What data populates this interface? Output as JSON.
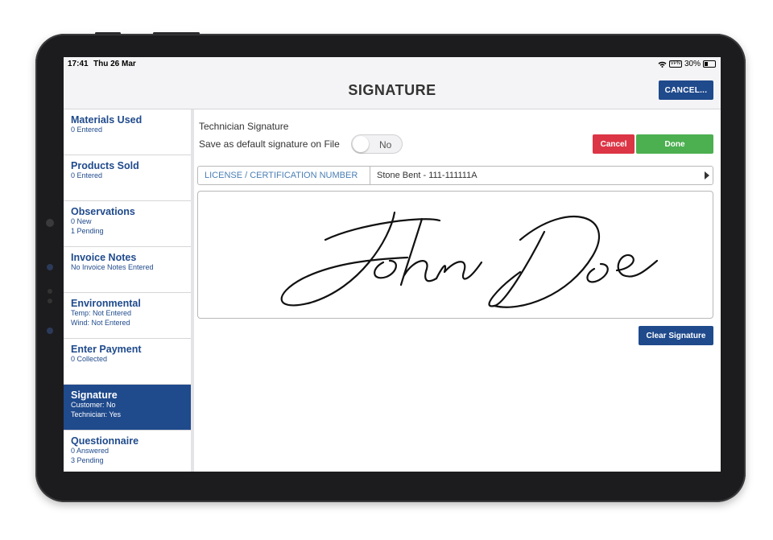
{
  "status_bar": {
    "time": "17:41",
    "date": "Thu 26 Mar",
    "vpn": "VPN",
    "battery": "30%",
    "icons": [
      "wifi-icon",
      "vpn-icon",
      "battery-icon"
    ]
  },
  "header": {
    "title": "SIGNATURE",
    "cancel_label": "CANCEL..."
  },
  "sidebar": {
    "items": [
      {
        "label": "Materials Used",
        "lines": [
          "0 Entered"
        ]
      },
      {
        "label": "Products Sold",
        "lines": [
          "0 Entered"
        ]
      },
      {
        "label": "Observations",
        "lines": [
          "0 New",
          "1 Pending"
        ]
      },
      {
        "label": "Invoice Notes",
        "lines": [
          "No Invoice Notes Entered"
        ]
      },
      {
        "label": "Environmental",
        "lines": [
          "Temp: Not Entered",
          "Wind: Not Entered"
        ]
      },
      {
        "label": "Enter Payment",
        "lines": [
          "0 Collected"
        ]
      },
      {
        "label": "Signature",
        "lines": [
          "Customer: No",
          "Technician: Yes"
        ],
        "active": true
      },
      {
        "label": "Questionnaire",
        "lines": [
          "0 Answered",
          "3 Pending"
        ]
      }
    ]
  },
  "main": {
    "section_title": "Technician Signature",
    "default_label": "Save as default signature on File",
    "toggle_value": "No",
    "cancel_label": "Cancel",
    "done_label": "Done",
    "license_label": "LICENSE / CERTIFICATION NUMBER",
    "license_value": "Stone Bent - 111-111111A",
    "clear_label": "Clear Signature"
  },
  "colors": {
    "primary": "#1f4a8c",
    "danger": "#dc3545",
    "success": "#4caf50",
    "license_text": "#4a7fb5"
  }
}
